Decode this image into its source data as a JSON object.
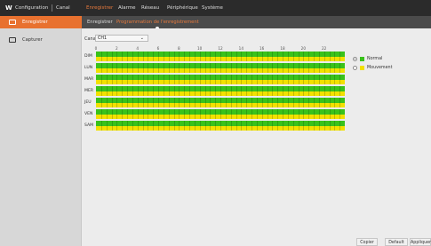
{
  "topbar": {
    "logo": "W",
    "title": "Configuration",
    "channel": "Canal",
    "menu": [
      "Enregistrer",
      "Alarme",
      "Réseau",
      "Périphérique",
      "Système"
    ],
    "active_index": 0
  },
  "sidebar": {
    "items": [
      {
        "label": "Enregistrer",
        "icon": "record-icon",
        "active": true
      },
      {
        "label": "Capturer",
        "icon": "camera-icon",
        "active": false
      }
    ]
  },
  "subtabs": {
    "items": [
      "Enregistrer",
      "Programmation de l'enregistrement"
    ],
    "active_index": 1
  },
  "canal": {
    "label": "Canal",
    "value": "CH1"
  },
  "schedule": {
    "hours": [
      "0",
      "2",
      "4",
      "6",
      "8",
      "10",
      "12",
      "14",
      "16",
      "18",
      "20",
      "22"
    ],
    "days": [
      "DIM",
      "LUN",
      "MAR",
      "MER",
      "JEU",
      "VEN",
      "SAM"
    ],
    "colors": {
      "normal": "#39c21b",
      "movement": "#f2e100"
    }
  },
  "legend": [
    {
      "label": "Normal",
      "selected": true,
      "color": "#39c21b"
    },
    {
      "label": "Mouvement",
      "selected": false,
      "color": "#f2e100"
    }
  ],
  "footer": {
    "buttons": [
      "Copier",
      "Default",
      "Appliquer"
    ]
  }
}
